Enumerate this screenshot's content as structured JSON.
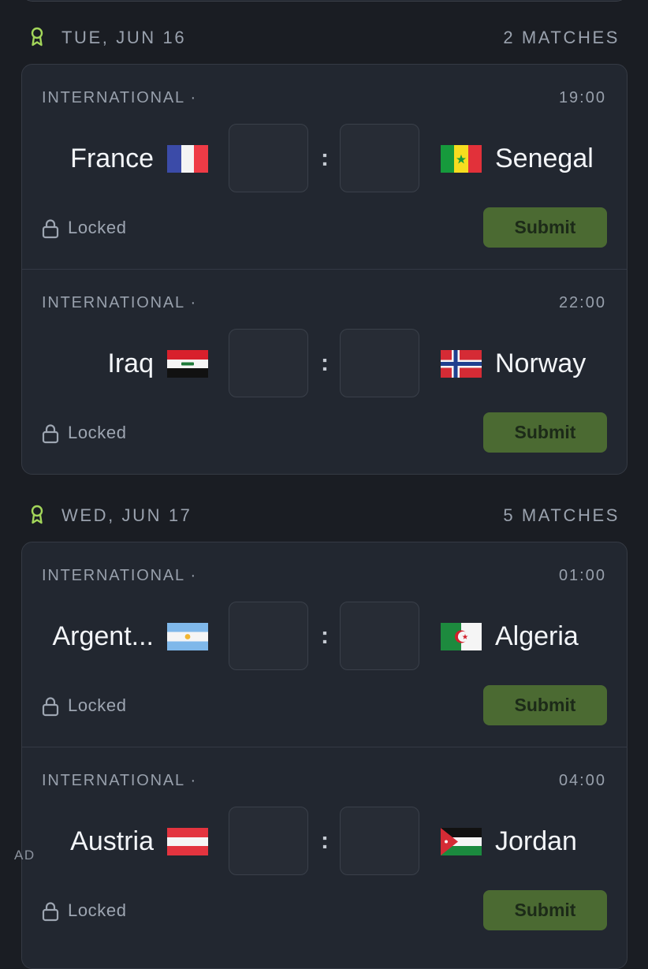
{
  "days": [
    {
      "title": "TUE, JUN 16",
      "count": "2 MATCHES",
      "matches": [
        {
          "league": "INTERNATIONAL ·",
          "time": "19:00",
          "home": "France",
          "away": "Senegal",
          "home_flag": "flag-france",
          "away_flag": "flag-senegal",
          "status": "Locked",
          "submit": "Submit"
        },
        {
          "league": "INTERNATIONAL ·",
          "time": "22:00",
          "home": "Iraq",
          "away": "Norway",
          "home_flag": "flag-iraq",
          "away_flag": "flag-norway",
          "status": "Locked",
          "submit": "Submit"
        }
      ]
    },
    {
      "title": "WED, JUN 17",
      "count": "5 MATCHES",
      "matches": [
        {
          "league": "INTERNATIONAL ·",
          "time": "01:00",
          "home": "Argent...",
          "away": "Algeria",
          "home_flag": "flag-argentina",
          "away_flag": "flag-algeria",
          "status": "Locked",
          "submit": "Submit"
        },
        {
          "league": "INTERNATIONAL ·",
          "time": "04:00",
          "home": "Austria",
          "away": "Jordan",
          "home_flag": "flag-austria",
          "away_flag": "flag-jordan",
          "status": "Locked",
          "submit": "Submit"
        }
      ]
    }
  ],
  "ad_label": "AD",
  "colors": {
    "accent": "#a3d65a",
    "submit_bg": "#4b6a32",
    "card_bg": "#222730",
    "page_bg": "#1a1d23"
  }
}
